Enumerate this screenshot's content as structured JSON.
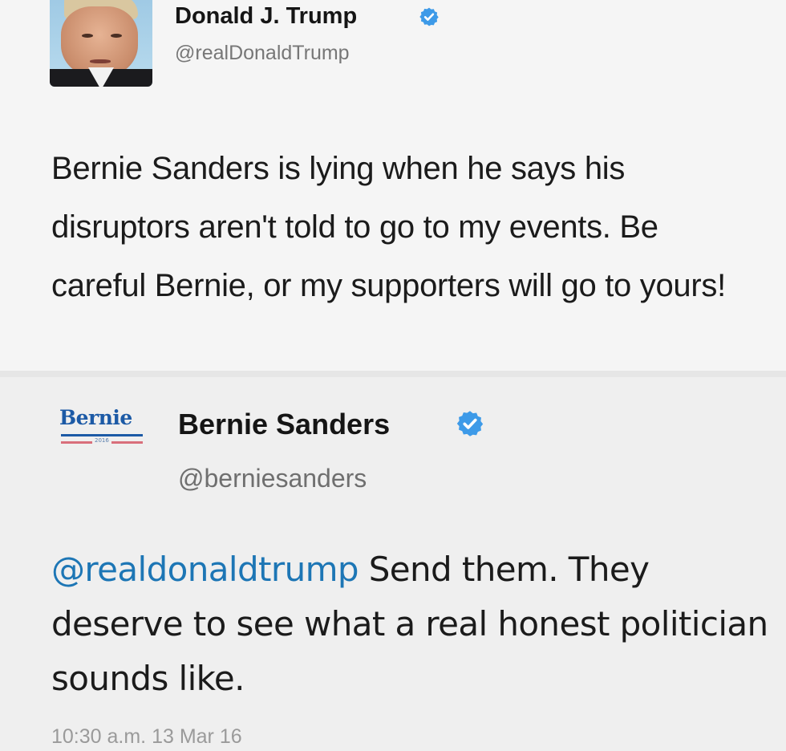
{
  "tweets": [
    {
      "author_name": "Donald J. Trump",
      "handle": "@realDonaldTrump",
      "verified": true,
      "text": "Bernie Sanders is lying when he says his disruptors aren't told to go to my events. Be careful Bernie, or my supporters will go to yours!"
    },
    {
      "author_name": "Bernie Sanders",
      "handle": "@berniesanders",
      "verified": true,
      "logo_text": "Bernie",
      "logo_year": "2016",
      "mention": "@realdonaldtrump",
      "text": " Send them. They deserve to see what a real honest politician sounds like.",
      "timestamp": "10:30 a.m. 13 Mar 16"
    }
  ],
  "colors": {
    "verified_badge": "#3d9ae8",
    "mention": "#1d76b5",
    "bernie_logo_blue": "#1c5aa6",
    "bernie_logo_red": "#d0394a"
  },
  "icons": [
    "verified-badge-icon"
  ]
}
